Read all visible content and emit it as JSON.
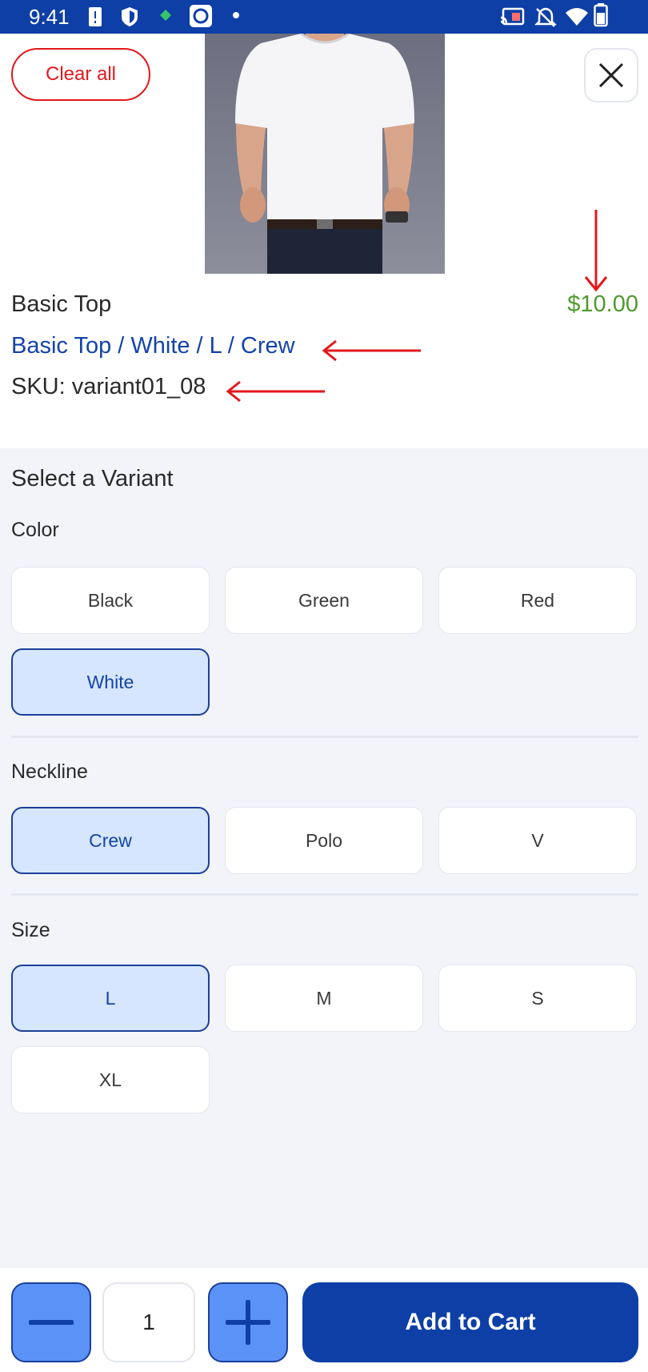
{
  "status_bar": {
    "time": "9:41"
  },
  "header": {
    "clear_label": "Clear all"
  },
  "product": {
    "name": "Basic Top",
    "price": "$10.00",
    "variant_title": "Basic Top / White / L / Crew",
    "sku": "SKU: variant01_08",
    "image_desc_icon": "tshirt-photo"
  },
  "variants": {
    "title": "Select a Variant",
    "color": {
      "label": "Color",
      "options": [
        "Black",
        "Green",
        "Red",
        "White"
      ],
      "selected": "White"
    },
    "neckline": {
      "label": "Neckline",
      "options": [
        "Crew",
        "Polo",
        "V"
      ],
      "selected": "Crew"
    },
    "size": {
      "label": "Size",
      "options": [
        "L",
        "M",
        "S",
        "XL"
      ],
      "selected": "L"
    }
  },
  "cart": {
    "quantity": "1",
    "add_label": "Add to Cart"
  },
  "colors": {
    "brand": "#0d3fa6",
    "accent_light": "#5b92f7",
    "selected_bg": "#d6e6ff",
    "price": "#4f9a2e",
    "danger": "#e1191d",
    "variant_link": "#1444a8",
    "annotation_arrow": "#e1191d"
  }
}
